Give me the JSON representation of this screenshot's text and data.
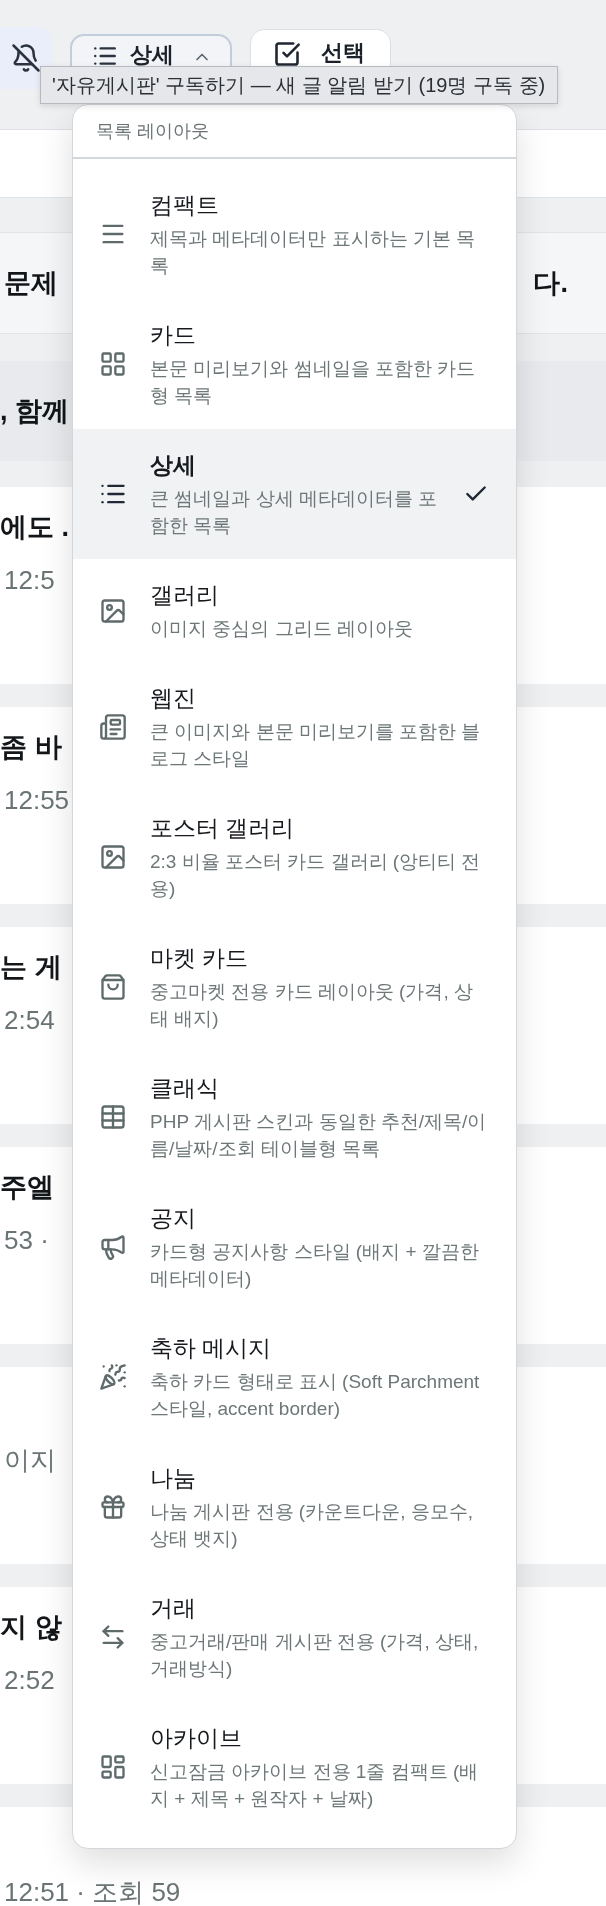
{
  "toolbar": {
    "layout_button": {
      "label": "상세",
      "expanded": true
    },
    "select_button": {
      "label": "선택"
    },
    "tooltip": "'자유게시판' 구독하기 — 새 글 알림 받기 (19명 구독 중)"
  },
  "layout_menu": {
    "header": "목록 레이아웃",
    "items": [
      {
        "kind": "compact",
        "title": "컴팩트",
        "description": "제목과 메타데이터만 표시하는 기본 목록",
        "selected": false
      },
      {
        "kind": "card",
        "title": "카드",
        "description": "본문 미리보기와 썸네일을 포함한 카드형 목록",
        "selected": false
      },
      {
        "kind": "detail",
        "title": "상세",
        "description": "큰 썸네일과 상세 메타데이터를 포함한 목록",
        "selected": true
      },
      {
        "kind": "gallery",
        "title": "갤러리",
        "description": "이미지 중심의 그리드 레이아웃",
        "selected": false
      },
      {
        "kind": "webzine",
        "title": "웹진",
        "description": "큰 이미지와 본문 미리보기를 포함한 블로그 스타일",
        "selected": false
      },
      {
        "kind": "poster_gallery",
        "title": "포스터 갤러리",
        "description": "2:3 비율 포스터 카드 갤러리 (앙티티 전용)",
        "selected": false
      },
      {
        "kind": "market_card",
        "title": "마켓 카드",
        "description": "중고마켓 전용 카드 레이아웃 (가격, 상태 배지)",
        "selected": false
      },
      {
        "kind": "classic",
        "title": "클래식",
        "description": "PHP 게시판 스킨과 동일한 추천/제목/이름/날짜/조회 테이블형 목록",
        "selected": false
      },
      {
        "kind": "notice",
        "title": "공지",
        "description": "카드형 공지사항 스타일 (배지 + 깔끔한 메타데이터)",
        "selected": false
      },
      {
        "kind": "celebration",
        "title": "축하 메시지",
        "description": "축하 카드 형태로 표시 (Soft Parchment 스타일, accent border)",
        "selected": false
      },
      {
        "kind": "sharing",
        "title": "나눔",
        "description": "나눔 게시판 전용 (카운트다운, 응모수, 상태 뱃지)",
        "selected": false
      },
      {
        "kind": "trade",
        "title": "거래",
        "description": "중고거래/판매 게시판 전용 (가격, 상태, 거래방식)",
        "selected": false
      },
      {
        "kind": "archive",
        "title": "아카이브",
        "description": "신고잠금 아카이브 전용 1줄 컴팩트 (배지 + 제목 + 원작자 + 날짜)",
        "selected": false
      }
    ]
  },
  "board": {
    "notice": {
      "left": "문제",
      "right": "다."
    },
    "banner": {
      "left": ", 함께"
    },
    "posts": [
      {
        "title": "에도 .",
        "meta": "12:5"
      },
      {
        "title": "좀 바",
        "meta": "12:55"
      },
      {
        "title": "는 게",
        "meta": "2:54"
      },
      {
        "title": "주엘",
        "meta": "53 ·"
      },
      {
        "meta": "이지"
      },
      {
        "title": "지 않",
        "meta": "2:52"
      },
      {
        "meta": "12:51 · 조회 59"
      }
    ]
  }
}
